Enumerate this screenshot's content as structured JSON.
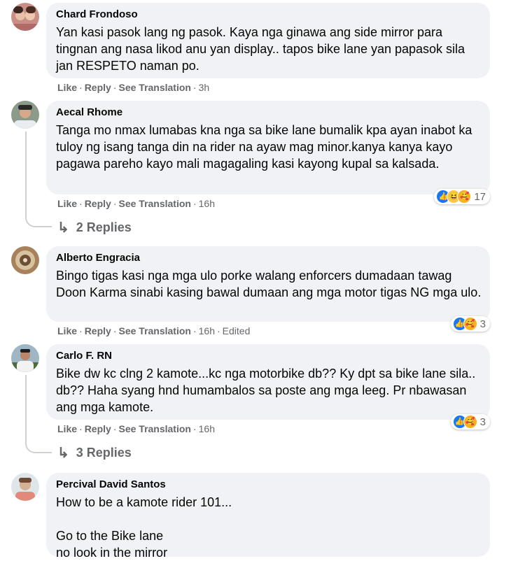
{
  "comments": [
    {
      "author": "Chard Frondoso",
      "text": "Yan kasi pasok lang ng pasok. Kaya nga ginawa ang side mirror para tingnan ang nasa likod anu yan display.. tapos bike lane yan papasok sila jan RESPETO naman po.",
      "like": "Like",
      "reply": "Reply",
      "translate": "See Translation",
      "time": "3h"
    },
    {
      "author": "Aecal Rhome",
      "text": "Tanga mo nmax lumabas kna nga sa bike lane bumalik kpa ayan inabot ka tuloy ng isang tanga din na rider na ayaw mag minor.kanya kanya kayo pagawa pareho kayo mali magagaling kasi kayong kupal sa kalsada.",
      "like": "Like",
      "reply": "Reply",
      "translate": "See Translation",
      "time": "16h",
      "reaction_count": "17",
      "replies_label": "2 Replies"
    },
    {
      "author": "Alberto Engracia",
      "text": "Bingo tigas kasi nga mga ulo porke walang enforcers dumadaan tawag Doon Karma sinabi kasing bawal dumaan ang mga motor tigas NG mga ulo.",
      "like": "Like",
      "reply": "Reply",
      "translate": "See Translation",
      "time": "16h",
      "edited": "Edited",
      "reaction_count": "3"
    },
    {
      "author": "Carlo F. RN",
      "text": "Bike dw kc clng 2 kamote...kc nga motorbike db?? Ky dpt sa bike lane sila.. db?? Haha syang hnd humambalos sa poste ang mga leeg. Pr nbawasan ang mga kamote.",
      "like": "Like",
      "reply": "Reply",
      "translate": "See Translation",
      "time": "16h",
      "reaction_count": "3",
      "replies_label": "3 Replies"
    },
    {
      "author": "Percival David Santos",
      "text": "How to be a kamote rider 101...\n\nGo to the Bike lane\nno look in the mirror"
    }
  ],
  "reaction_icons": [
    "like-icon",
    "haha-icon",
    "care-icon"
  ],
  "colors": {
    "bubble": "#f0f2f5",
    "meta": "#65676b",
    "like": "#1877f2"
  }
}
